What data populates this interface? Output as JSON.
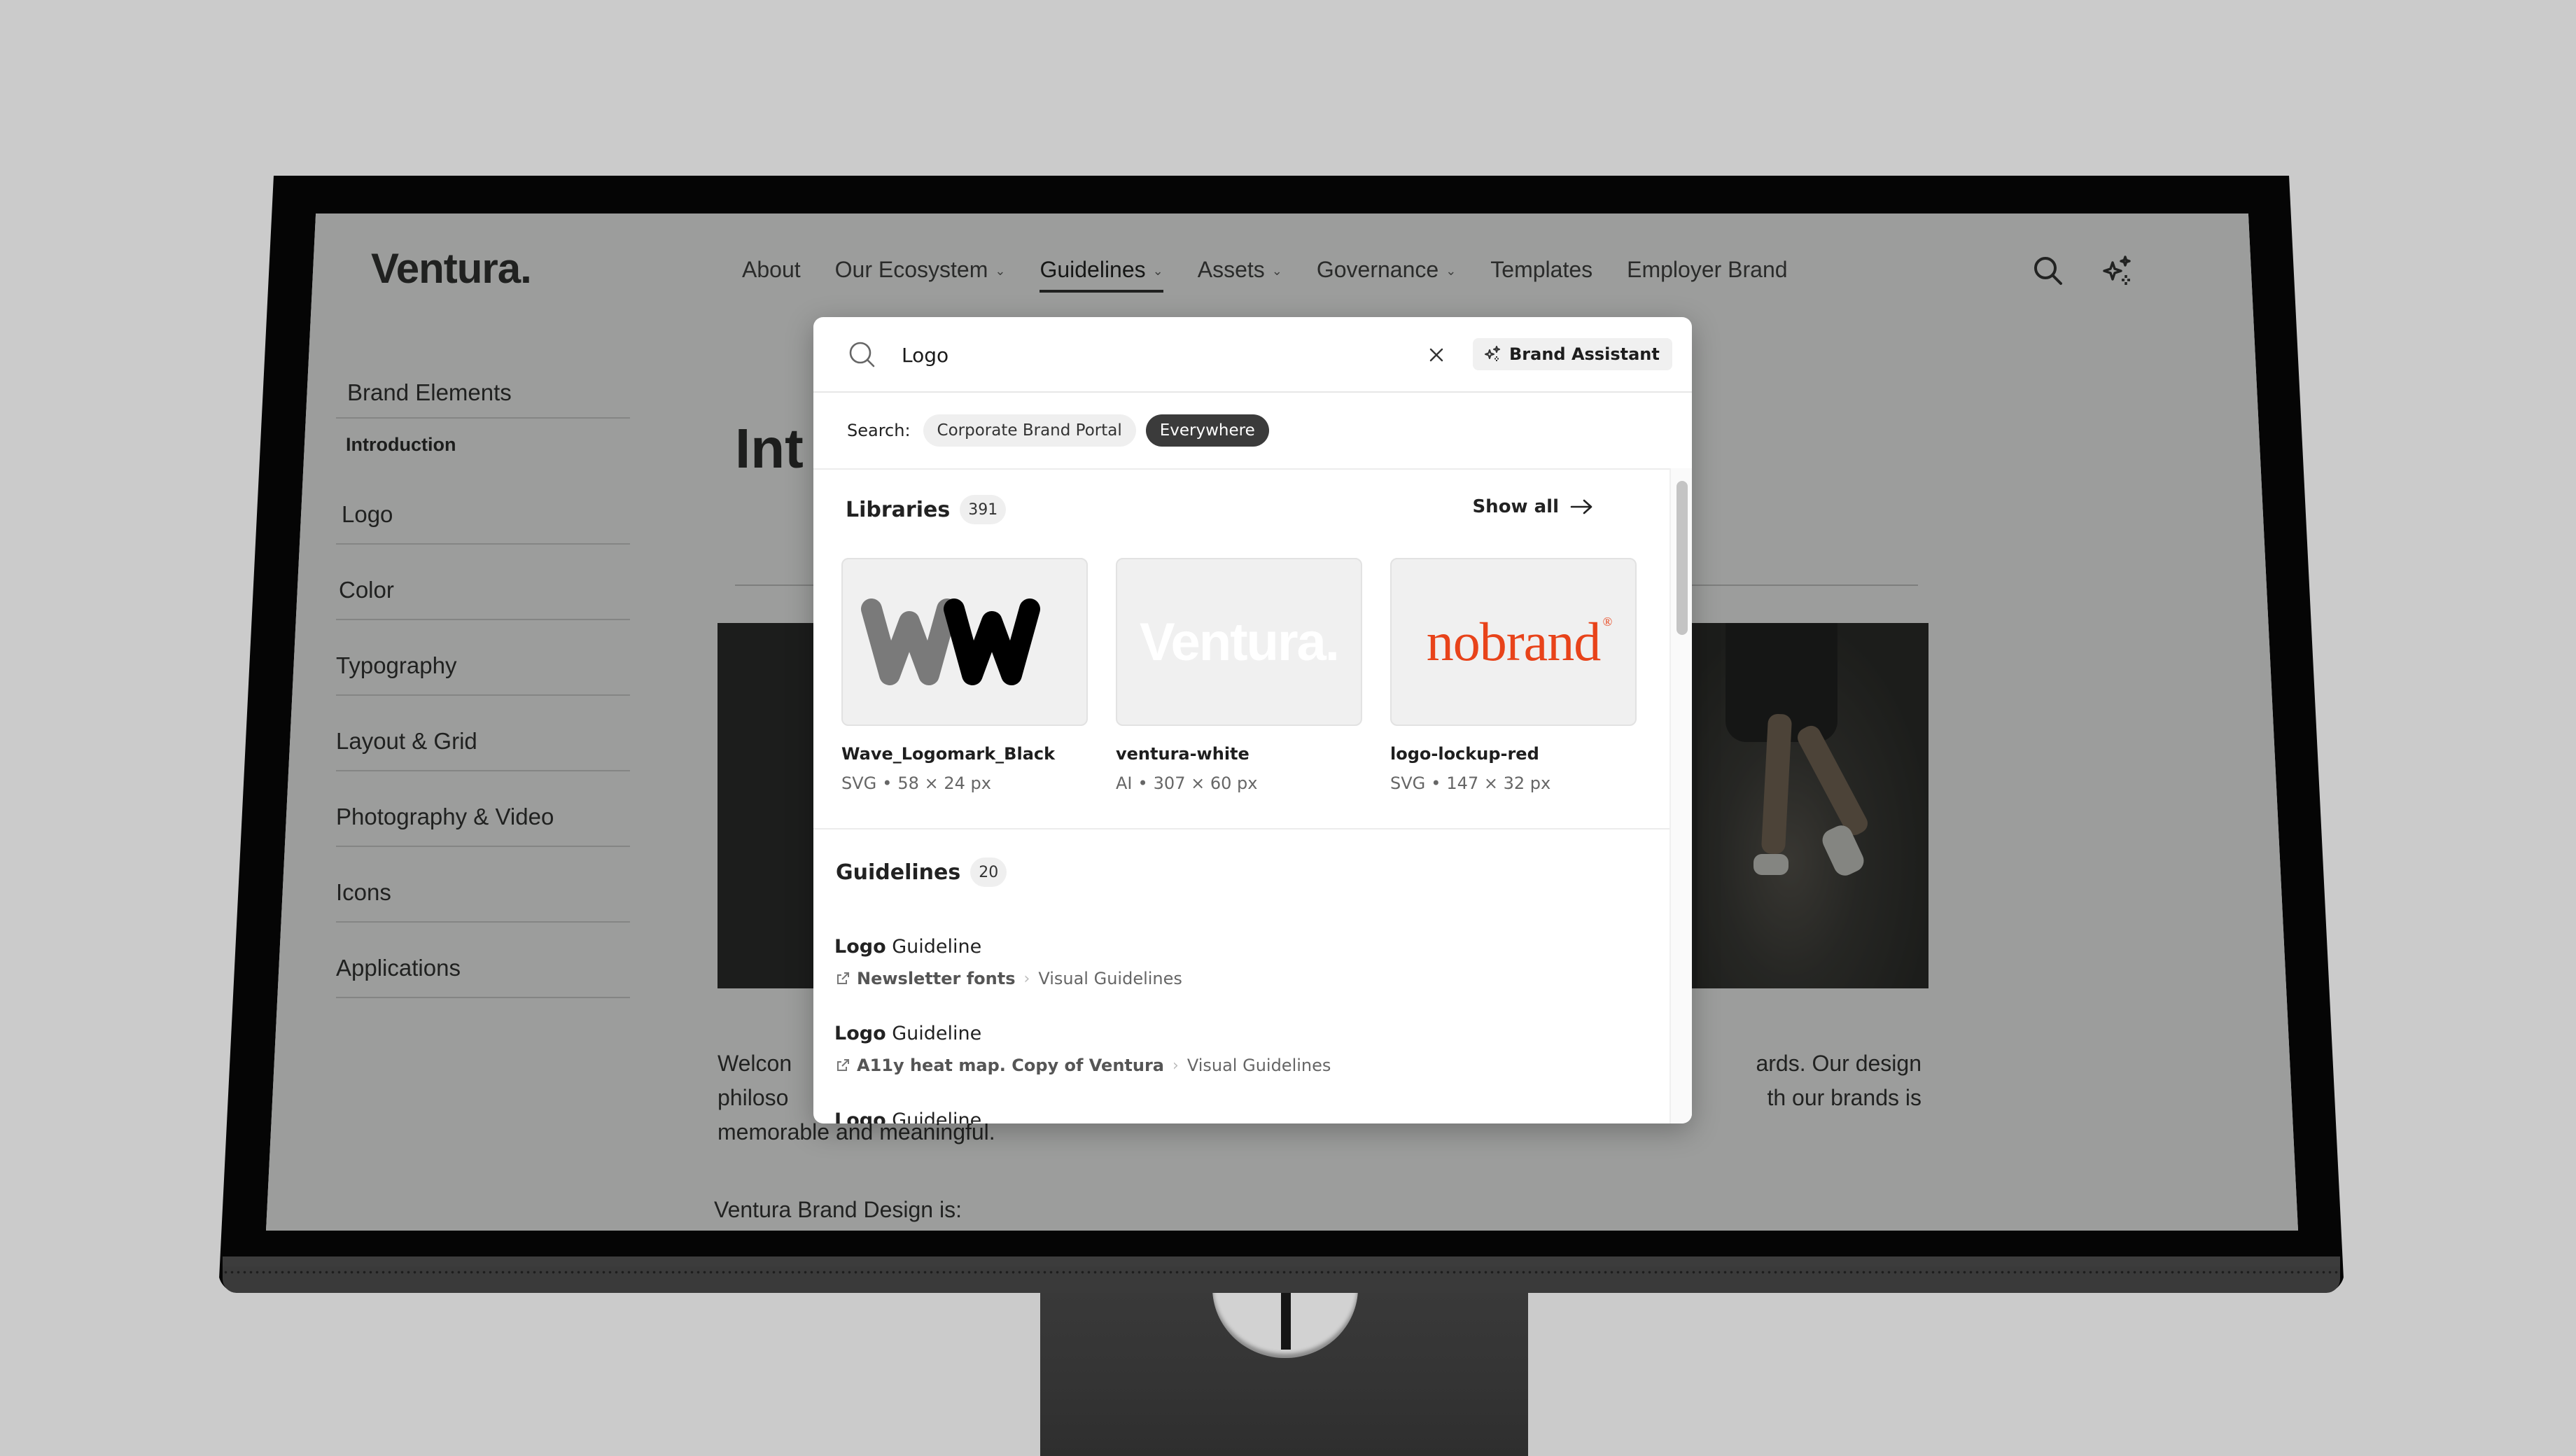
{
  "site": {
    "logo": "Ventura.",
    "nav": [
      {
        "label": "About",
        "has_dropdown": false,
        "active": false
      },
      {
        "label": "Our Ecosystem",
        "has_dropdown": true,
        "active": false
      },
      {
        "label": "Guidelines",
        "has_dropdown": true,
        "active": true
      },
      {
        "label": "Assets",
        "has_dropdown": true,
        "active": false
      },
      {
        "label": "Governance",
        "has_dropdown": true,
        "active": false
      },
      {
        "label": "Templates",
        "has_dropdown": false,
        "active": false
      },
      {
        "label": "Employer Brand",
        "has_dropdown": false,
        "active": false
      }
    ],
    "header_icons": [
      "search-icon",
      "sparkles-icon"
    ]
  },
  "sidebar": {
    "group": "Brand Elements",
    "current": "Introduction",
    "items": [
      "Logo",
      "Color",
      "Typography",
      "Layout & Grid",
      "Photography & Video",
      "Icons",
      "Applications"
    ]
  },
  "content": {
    "title_visible": "Int",
    "paragraph_left_line1": "Welcon",
    "paragraph_left_line2": "philoso",
    "paragraph_right_line1": "ards. Our design",
    "paragraph_right_line2": "th our brands is",
    "paragraph_line3": "memorable and meaningful.",
    "subheading": "Ventura Brand Design is:"
  },
  "search_modal": {
    "query": "Logo",
    "clear_icon": "close-icon",
    "assistant_button": "Brand Assistant",
    "scope_label": "Search:",
    "scopes": [
      {
        "label": "Corporate Brand Portal",
        "active": false
      },
      {
        "label": "Everywhere",
        "active": true
      }
    ],
    "libraries": {
      "title": "Libraries",
      "count": "391",
      "show_all": "Show all",
      "assets": [
        {
          "name": "Wave_Logomark_Black",
          "format": "SVG",
          "dimensions": "58 × 24 px"
        },
        {
          "name": "ventura-white",
          "format": "AI",
          "dimensions": "307 × 60 px",
          "preview_text": "Ventura."
        },
        {
          "name": "logo-lockup-red",
          "format": "SVG",
          "dimensions": "147 × 32 px",
          "preview_text": "nobrand",
          "preview_color": "#e8431a"
        }
      ]
    },
    "guidelines": {
      "title": "Guidelines",
      "count": "20",
      "results": [
        {
          "match": "Logo",
          "rest": " Guideline",
          "source": "Newsletter fonts",
          "section": "Visual Guidelines"
        },
        {
          "match": "Logo",
          "rest": " Guideline",
          "source": "A11y heat map. Copy of Ventura",
          "section": "Visual Guidelines"
        },
        {
          "match": "Logo",
          "rest": " Guideline",
          "source": "",
          "section": ""
        }
      ]
    }
  },
  "colors": {
    "backdrop": "#cbcbcb",
    "bezel": "#050505",
    "accent_red": "#e8431a",
    "chip_active": "#3b3b3b"
  }
}
